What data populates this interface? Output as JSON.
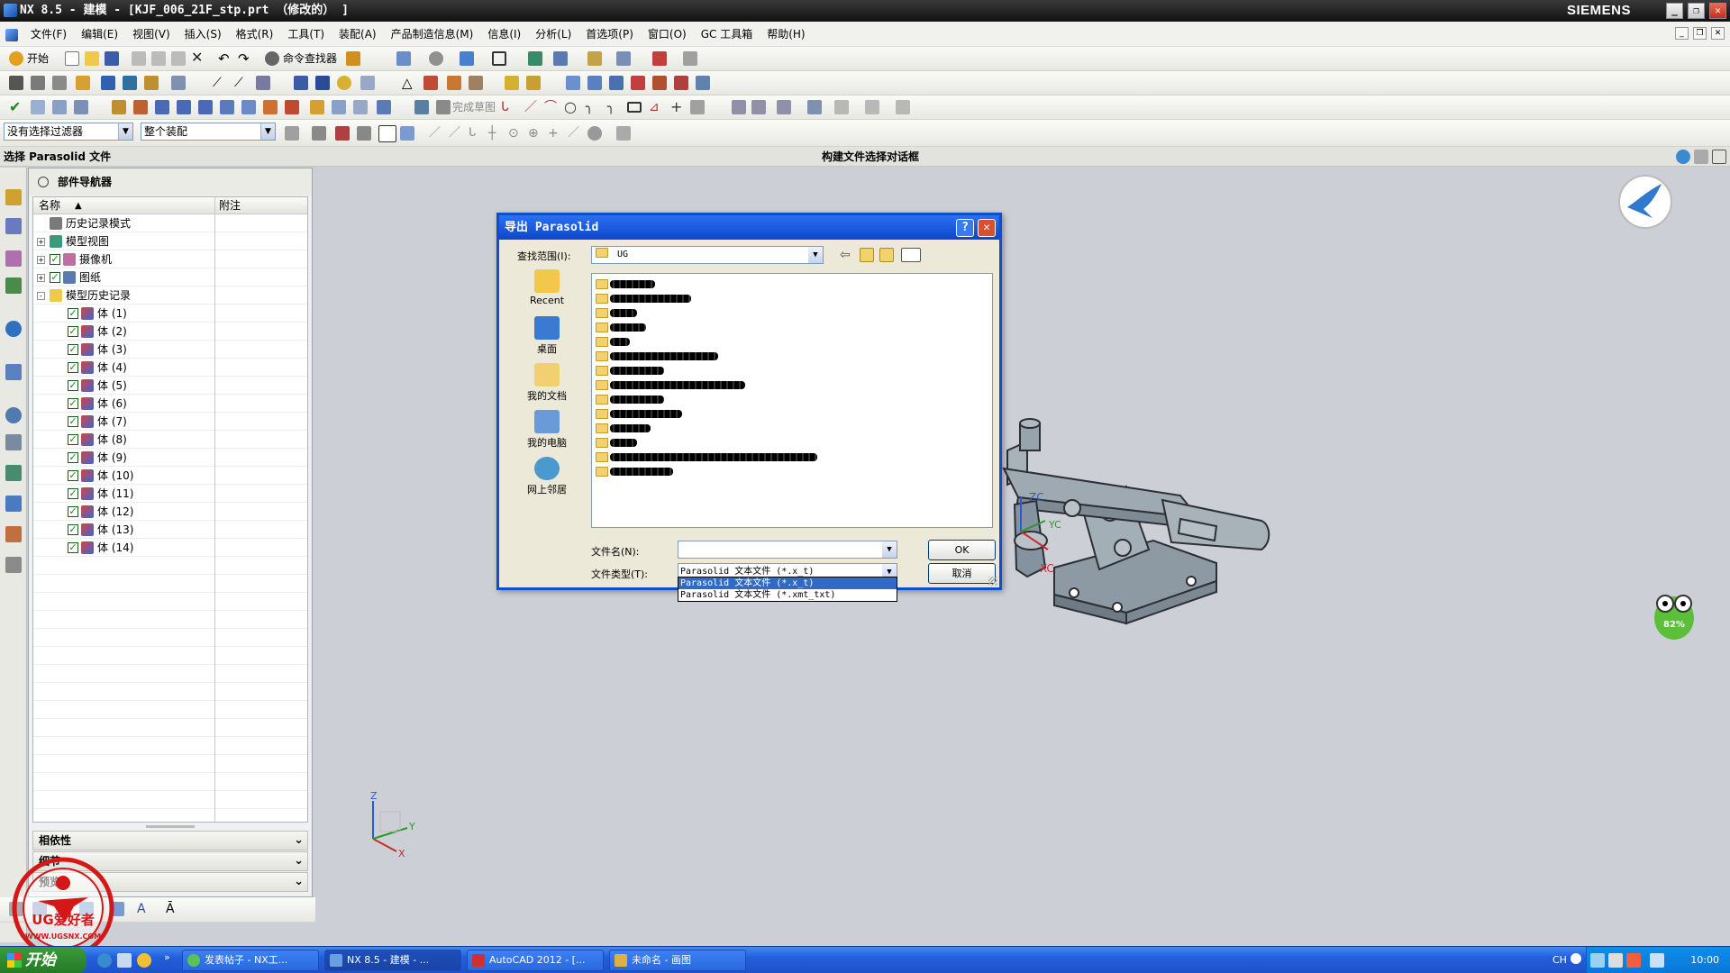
{
  "window": {
    "title": "NX 8.5 - 建模 - [KJF_006_21F_stp.prt  （修改的） ]",
    "brand": "SIEMENS",
    "min": "_",
    "restore": "❐",
    "close": "✕"
  },
  "menu": {
    "items": [
      "文件(F)",
      "编辑(E)",
      "视图(V)",
      "插入(S)",
      "格式(R)",
      "工具(T)",
      "装配(A)",
      "产品制造信息(M)",
      "信息(I)",
      "分析(L)",
      "首选项(P)",
      "窗口(O)",
      "GC 工具箱",
      "帮助(H)"
    ]
  },
  "toolbar": {
    "start_label": "开始",
    "command_finder": "命令查找器",
    "finish_sketch": "完成草图"
  },
  "filters": {
    "selection_filter": "没有选择过滤器",
    "scope": "整个装配"
  },
  "cue": {
    "prompt": "选择 Parasolid 文件",
    "status": "构建文件选择对话框"
  },
  "navigator": {
    "title": "部件导航器",
    "col_name": "名称",
    "col_comment": "附注",
    "nodes": [
      {
        "label": "历史记录模式",
        "level": 0,
        "exp": "",
        "check": false
      },
      {
        "label": "模型视图",
        "level": 0,
        "exp": "+",
        "check": false
      },
      {
        "label": "摄像机",
        "level": 0,
        "exp": "+",
        "check": true
      },
      {
        "label": "图纸",
        "level": 0,
        "exp": "+",
        "check": true
      },
      {
        "label": "模型历史记录",
        "level": 0,
        "exp": "-",
        "check": false
      },
      {
        "label": "体 (1)",
        "level": 1,
        "exp": "",
        "check": true
      },
      {
        "label": "体 (2)",
        "level": 1,
        "exp": "",
        "check": true
      },
      {
        "label": "体 (3)",
        "level": 1,
        "exp": "",
        "check": true
      },
      {
        "label": "体 (4)",
        "level": 1,
        "exp": "",
        "check": true
      },
      {
        "label": "体 (5)",
        "level": 1,
        "exp": "",
        "check": true
      },
      {
        "label": "体 (6)",
        "level": 1,
        "exp": "",
        "check": true
      },
      {
        "label": "体 (7)",
        "level": 1,
        "exp": "",
        "check": true
      },
      {
        "label": "体 (8)",
        "level": 1,
        "exp": "",
        "check": true
      },
      {
        "label": "体 (9)",
        "level": 1,
        "exp": "",
        "check": true
      },
      {
        "label": "体 (10)",
        "level": 1,
        "exp": "",
        "check": true
      },
      {
        "label": "体 (11)",
        "level": 1,
        "exp": "",
        "check": true
      },
      {
        "label": "体 (12)",
        "level": 1,
        "exp": "",
        "check": true
      },
      {
        "label": "体 (13)",
        "level": 1,
        "exp": "",
        "check": true
      },
      {
        "label": "体 (14)",
        "level": 1,
        "exp": "",
        "check": true
      }
    ],
    "sections": [
      "相依性",
      "细节",
      "预览"
    ]
  },
  "dialog": {
    "title": "导出 Parasolid",
    "help": "?",
    "close": "✕",
    "look_in_label": "查找范围(I):",
    "look_in_value": "UG",
    "places": [
      "Recent",
      "桌面",
      "我的文档",
      "我的电脑",
      "网上邻居"
    ],
    "file_name_label": "文件名(N):",
    "file_name_value": "",
    "file_type_label": "文件类型(T):",
    "file_type_value": "Parasolid 文本文件 (*.x_t)",
    "file_type_options": [
      "Parasolid 文本文件 (*.x_t)",
      "Parasolid 文本文件 (*.xmt_txt)"
    ],
    "ok": "OK",
    "cancel": "取消"
  },
  "viewport": {
    "axis_zc": "ZC",
    "axis_xc": "XC",
    "axis_yc": "YC",
    "triad_z": "Z",
    "triad_x": "X",
    "triad_y": "Y",
    "mascot_pct": "82%"
  },
  "watermark": {
    "line1": "UG爱好者",
    "line2": "WWW.UGSNX.COM"
  },
  "taskbar": {
    "start": "开始",
    "tasks": [
      "发表帖子 - NX工...",
      "NX 8.5 - 建模 - ...",
      "AutoCAD 2012 - [...",
      "未命名 - 画图"
    ],
    "lang": "CH",
    "time": "10:00"
  },
  "colors": {
    "xp_blue": "#0f4ed3",
    "taskbar": "#245edb",
    "highlight": "#316ac5"
  }
}
